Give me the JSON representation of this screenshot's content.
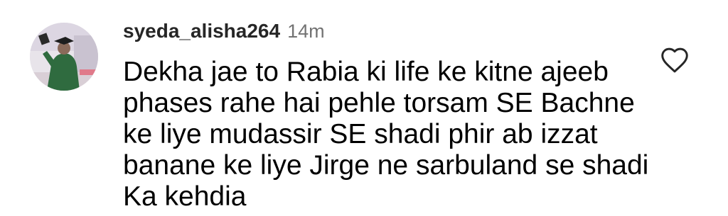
{
  "comment": {
    "username": "syeda_alisha264",
    "timestamp": "14m",
    "text_lines": [
      "Dekha jae to Rabia ki life ke kitne ajeeb",
      "phases rahe hai pehle torsam SE Bachne",
      "ke liye mudassir SE shadi phir ab izzat",
      "banane ke liye Jirge ne sarbuland se shadi",
      "Ka kehdia"
    ],
    "avatar_icon": "profile-photo",
    "like_icon": "heart-outline-icon"
  },
  "colors": {
    "username": "#262626",
    "timestamp": "#737373",
    "text": "#000000",
    "icon_stroke": "#262626"
  }
}
